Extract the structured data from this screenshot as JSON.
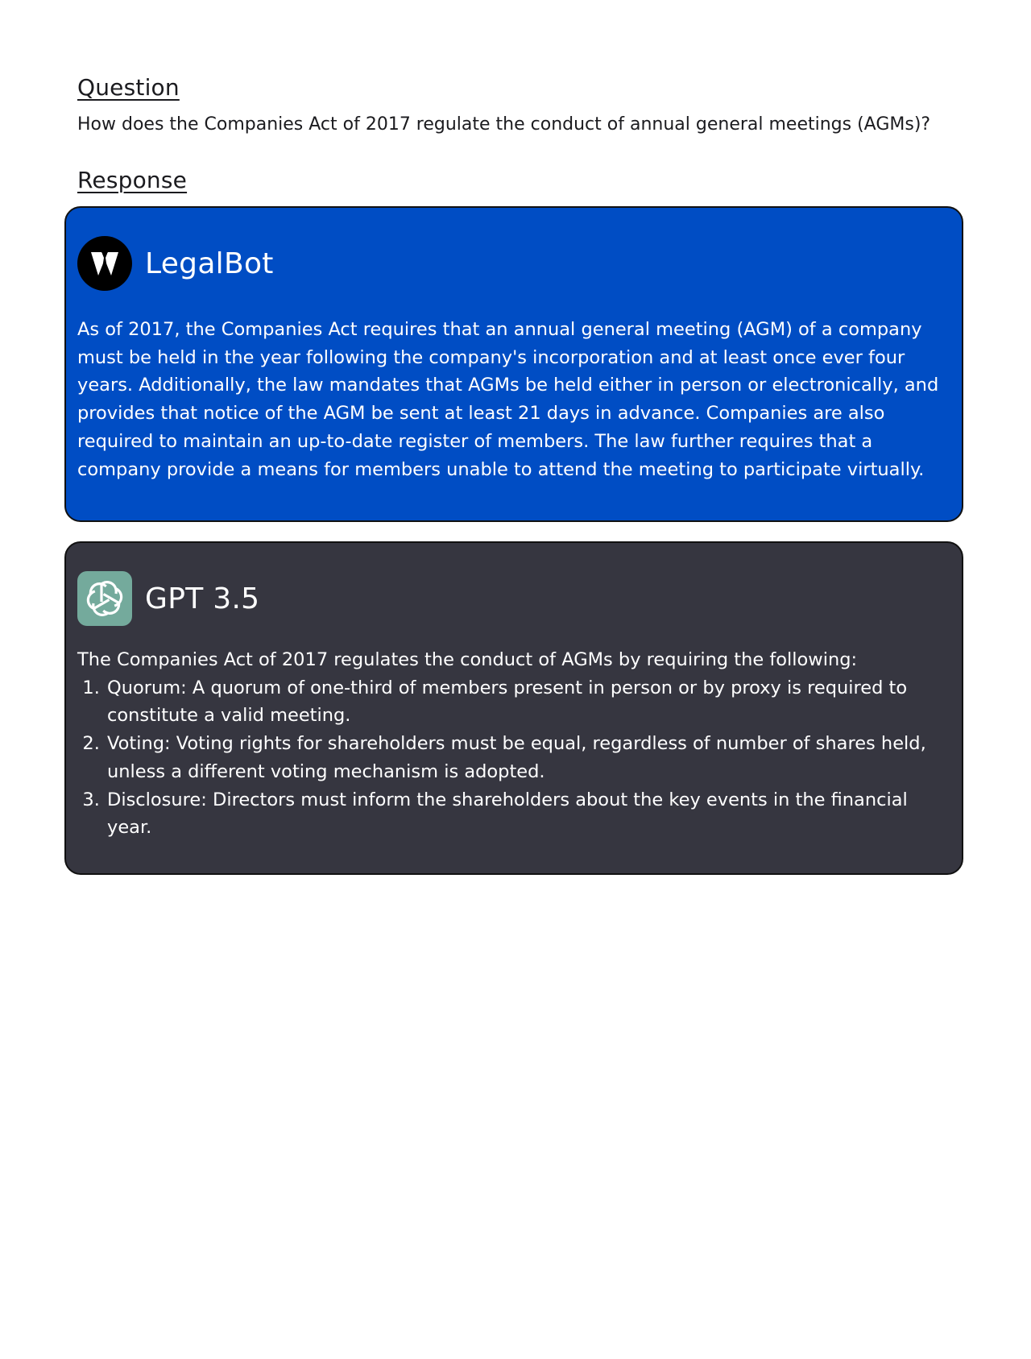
{
  "question": {
    "heading": "Question",
    "text": "How does the Companies Act of 2017 regulate the conduct of annual general meetings (AGMs)?"
  },
  "response": {
    "heading": "Response"
  },
  "responses": [
    {
      "name": "LegalBot",
      "icon": "suit-tie-icon",
      "color": "#004dc4",
      "text": "As of 2017, the Companies Act requires that an annual general meeting (AGM) of a company must be held in the year following the company's incorporation and at least once ever four years. Additionally, the law mandates that AGMs be held either in person or electronically, and provides that notice of the AGM be sent at least 21 days in advance. Companies are also required to maintain an up-to-date register of members. The law further requires that a company provide a means for members unable to attend the meeting to participate virtually."
    },
    {
      "name": "GPT 3.5",
      "icon": "openai-logo-icon",
      "color": "#363640",
      "intro": "The Companies Act of 2017 regulates the conduct of AGMs by requiring the following:",
      "points": [
        "Quorum: A quorum of one-third of members present in person or by proxy is required to constitute a valid meeting.",
        "Voting: Voting rights for shareholders must be equal, regardless of number of shares held, unless a different voting mechanism is adopted.",
        "Disclosure: Directors must inform the shareholders about the key events in the financial year."
      ]
    }
  ]
}
